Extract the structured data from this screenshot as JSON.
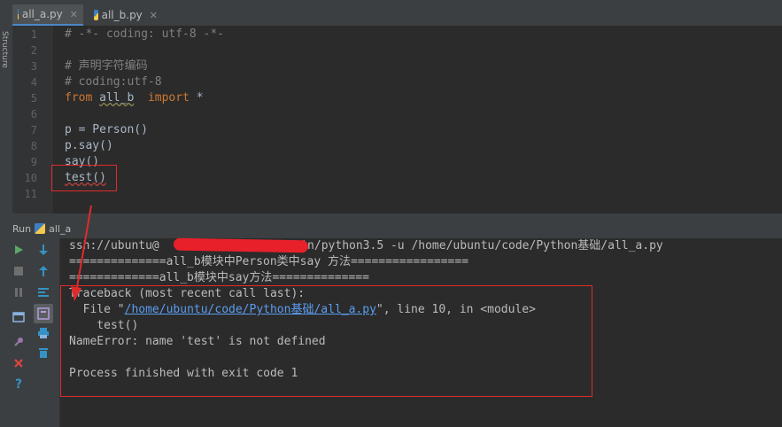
{
  "editor_tabs": [
    {
      "name": "all_a.py",
      "active": true
    },
    {
      "name": "all_b.py",
      "active": false
    }
  ],
  "tab_close_glyph": "✕",
  "left_tool_label": "Structure",
  "line_numbers": [
    "1",
    "2",
    "3",
    "4",
    "5",
    "6",
    "7",
    "8",
    "9",
    "10",
    "11"
  ],
  "code_lines": {
    "l1": "# -*- coding: utf-8 -*-",
    "l3": "# 声明字符编码",
    "l4": "# coding:utf-8",
    "l5_kw": "from",
    "l5_mod": "all_b",
    "l5_kw2": "import",
    "l5_star": "*",
    "l7": "p = Person()",
    "l8": "p.say()",
    "l9": "say()",
    "l10": "test()"
  },
  "run_panel": {
    "label": "Run",
    "config": "all_a"
  },
  "console": {
    "cmd_prefix": "ssh://ubuntu@",
    "cmd_suffix": "r/bin/python3.5 -u /home/ubuntu/code/Python基础/all_a.py",
    "line1": "==============all_b模块中Person类中say 方法=================",
    "line2": "=============all_b模块中say方法==============",
    "tb_header": "Traceback (most recent call last):",
    "file_prefix": "  File \"",
    "file_link": "/home/ubuntu/code/Python基础/all_a.py",
    "file_suffix": "\", line 10, in <module>",
    "tb_code": "    test()",
    "error": "NameError: name 'test' is not defined",
    "exit": "Process finished with exit code 1"
  },
  "colors": {
    "background": "#2b2b2b",
    "keyword": "#cc7832",
    "comment": "#808080",
    "error_text": "#ff6b68",
    "link": "#5a9df0",
    "annotation_red": "#e02b2b"
  },
  "toolbar_icons": [
    "run-icon",
    "rerun-down-icon",
    "stop-icon",
    "scroll-icon",
    "pause-icon",
    "layout-icon",
    "soft-wrap-icon",
    "pin-icon",
    "print-icon",
    "close-icon",
    "trash-icon",
    "help-icon"
  ]
}
